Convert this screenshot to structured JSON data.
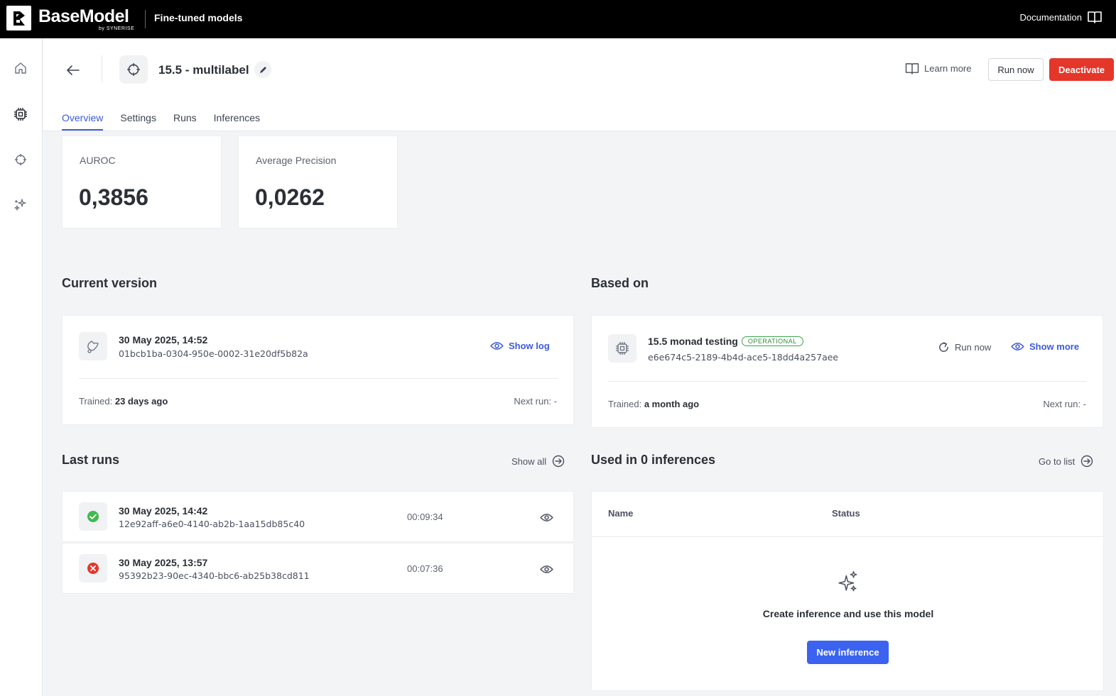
{
  "topbar": {
    "brand": "BaseModel",
    "brand_sub": "by SYNERISE",
    "section": "Fine-tuned models",
    "documentation": "Documentation"
  },
  "header": {
    "title": "15.5 - multilabel",
    "learn_more": "Learn more",
    "run_now": "Run now",
    "deactivate": "Deactivate",
    "tabs": [
      {
        "label": "Overview",
        "active": true
      },
      {
        "label": "Settings",
        "active": false
      },
      {
        "label": "Runs",
        "active": false
      },
      {
        "label": "Inferences",
        "active": false
      }
    ]
  },
  "metrics": [
    {
      "label": "AUROC",
      "value": "0,3856"
    },
    {
      "label": "Average Precision",
      "value": "0,0262"
    }
  ],
  "current_version": {
    "heading": "Current version",
    "date": "30 May 2025, 14:52",
    "id": "01bcb1ba-0304-950e-0002-31e20df5b82a",
    "show_log": "Show log",
    "trained_label": "Trained:",
    "trained_value": "23 days ago",
    "next_run": "Next run: -"
  },
  "based_on": {
    "heading": "Based on",
    "name": "15.5 monad testing",
    "status": "OPERATIONAL",
    "id": "e6e674c5-2189-4b4d-ace5-18dd4a257aee",
    "run_now": "Run now",
    "show_more": "Show more",
    "trained_label": "Trained:",
    "trained_value": "a month ago",
    "next_run": "Next run: -"
  },
  "last_runs": {
    "heading": "Last runs",
    "show_all": "Show all",
    "rows": [
      {
        "date": "30 May 2025, 14:42",
        "id": "12e92aff-a6e0-4140-ab2b-1aa15db85c40",
        "duration": "00:09:34",
        "status": "success"
      },
      {
        "date": "30 May 2025, 13:57",
        "id": "95392b23-90ec-4340-bbc6-ab25b38cd811",
        "duration": "00:07:36",
        "status": "failed"
      }
    ]
  },
  "inferences": {
    "heading": "Used in 0 inferences",
    "go_to_list": "Go to list",
    "col_name": "Name",
    "col_status": "Status",
    "empty_text": "Create inference and use this model",
    "new_inference": "New inference"
  },
  "colors": {
    "accent": "#3b5bdb",
    "danger": "#e5362a",
    "success": "#3fb950",
    "primary_button": "#3b63f0"
  }
}
